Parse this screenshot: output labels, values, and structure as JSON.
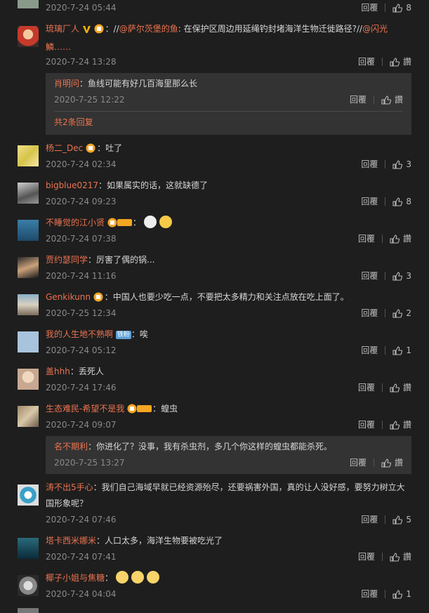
{
  "labels": {
    "reply": "回覆",
    "like": "讚"
  },
  "top_fragment": {
    "time": "2020-7-24 05:44",
    "likes": "8"
  },
  "comments": [
    {
      "user": "琉璃厂人",
      "prefix": "：//",
      "mention1": "@萨尔茨堡的鱼",
      "content": ": 在保护区周边用延绳钓封堵海洋生物迁徙路径?//",
      "mention2": "@闪光",
      "content2": "鱗……",
      "time": "2020-7-24 13:28",
      "likes": "讚",
      "replies": [
        {
          "user": "肖明问",
          "content": "：鱼线可能有好几百海里那么长",
          "time": "2020-7-25 12:22",
          "likes": "讚"
        }
      ],
      "more": "共2条回复"
    },
    {
      "user": "杨二_Dec",
      "content": "：吐了",
      "time": "2020-7-24 02:34",
      "likes": "3"
    },
    {
      "user": "bigblue0217",
      "content": "：如果属实的话，这就缺德了",
      "time": "2020-7-24 09:23",
      "likes": "8"
    },
    {
      "user": "不睡觉的江小贤",
      "content": "：",
      "time": "2020-7-24 07:38",
      "likes": "讚"
    },
    {
      "user": "贾约瑟同学",
      "content": "：厉害了偶的锅...",
      "time": "2020-7-24 11:16",
      "likes": "3"
    },
    {
      "user": "Genkikunn",
      "content": "：中国人也要少吃一点，不要把太多精力和关注点放在吃上面了。",
      "time": "2020-7-25 12:34",
      "likes": "2"
    },
    {
      "user": "我的人生地不熟啊",
      "badge": "铁粉",
      "content": "：唉",
      "time": "2020-7-24 05:12",
      "likes": "1"
    },
    {
      "user": "盖hhh",
      "content": "：丢死人",
      "time": "2020-7-24 17:46",
      "likes": "讚"
    },
    {
      "user": "生态难民-希望不是我",
      "content": "：蝗虫",
      "time": "2020-7-24 09:07",
      "likes": "讚",
      "replies": [
        {
          "user": "名不期利",
          "content": "：你进化了？没事，我有杀虫剂，多几个你这样的蝗虫都能杀死。",
          "time": "2020-7-25 13:27",
          "likes": "讚"
        }
      ]
    },
    {
      "user": "涛不出5手心",
      "content": "：我们自己海域早就已经资源殆尽，还要祸害外国，真的让人没好感，要努力树立大国形象呢？",
      "time": "2020-7-24 07:46",
      "likes": "5"
    },
    {
      "user": "塔卡西米娜米",
      "content": "：人口太多，海洋生物要被吃光了",
      "time": "2020-7-24 07:41",
      "likes": "讚"
    },
    {
      "user": "椰子小姐与焦糖",
      "content": "：",
      "time": "2020-7-24 04:04",
      "likes": "1"
    }
  ],
  "colors": {
    "username": "#eb7350",
    "background": "#1e1e1e",
    "subreply_bg": "#333333"
  }
}
